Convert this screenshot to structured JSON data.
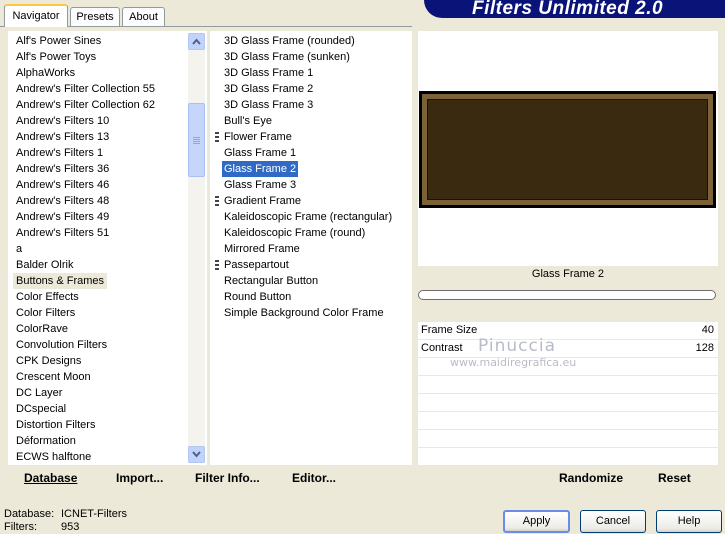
{
  "tabs": [
    "Navigator",
    "Presets",
    "About"
  ],
  "banner_title": "Filters Unlimited 2.0",
  "categories": [
    "Alf's Power Sines",
    "Alf's Power Toys",
    "AlphaWorks",
    "Andrew's Filter Collection 55",
    "Andrew's Filter Collection 62",
    "Andrew's Filters 10",
    "Andrew's Filters 13",
    "Andrew's Filters 1",
    "Andrew's Filters 36",
    "Andrew's Filters 46",
    "Andrew's Filters 48",
    "Andrew's Filters 49",
    "Andrew's Filters 51",
    "a",
    "Balder Olrik",
    "Buttons & Frames",
    "Color Effects",
    "Color Filters",
    "ColorRave",
    "Convolution Filters",
    "CPK Designs",
    "Crescent Moon",
    "DC Layer",
    "DCspecial",
    "Distortion Filters",
    "Déformation",
    "ECWS halftone"
  ],
  "selected_category": "Buttons & Frames",
  "filters": [
    "3D Glass Frame (rounded)",
    "3D Glass Frame (sunken)",
    "3D Glass Frame 1",
    "3D Glass Frame 2",
    "3D Glass Frame 3",
    "Bull's Eye",
    "Flower Frame",
    "Glass Frame 1",
    "Glass Frame 2",
    "Glass Frame 3",
    "Gradient Frame",
    "Kaleidoscopic Frame (rectangular)",
    "Kaleidoscopic Frame (round)",
    "Mirrored Frame",
    "Passepartout",
    "Rectangular Button",
    "Round Button",
    "Simple Background Color Frame"
  ],
  "selected_filter": "Glass Frame 2",
  "left_buttons": {
    "database": "Database",
    "import": "Import...",
    "filter_info": "Filter Info...",
    "editor": "Editor..."
  },
  "preview": {
    "filter_name": "Glass Frame 2",
    "frame_color": "#3a2a10",
    "border_color": "#7b6238"
  },
  "params": [
    {
      "label": "Frame Size",
      "value": "40"
    },
    {
      "label": "Contrast",
      "value": "128"
    }
  ],
  "watermark": {
    "line1": "Pinuccia",
    "line2": "www.maidiregrafica.eu"
  },
  "right_buttons": {
    "randomize": "Randomize",
    "reset": "Reset"
  },
  "status": {
    "database_label": "Database:",
    "database_value": "ICNET-Filters",
    "filters_label": "Filters:",
    "filters_value": "953"
  },
  "dialog_buttons": {
    "apply": "Apply",
    "cancel": "Cancel",
    "help": "Help"
  }
}
